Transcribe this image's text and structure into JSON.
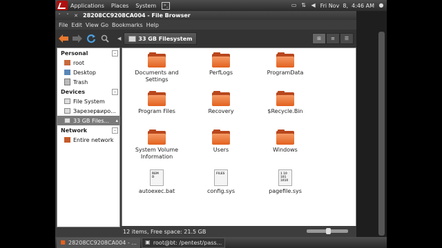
{
  "topbar": {
    "menus": [
      "Applications",
      "Places",
      "System"
    ],
    "clock": "Fri Nov  8,  4:46 AM"
  },
  "window": {
    "title": "28208CC9208CA004 - File Browser",
    "menu": [
      "File",
      "Edit",
      "View",
      "Go",
      "Bookmarks",
      "Help"
    ]
  },
  "toolbar": {
    "path_label": "33 GB Filesystem"
  },
  "sidebar": {
    "sections": [
      {
        "title": "Personal",
        "items": [
          {
            "label": "root",
            "icon": "home-folder-icon"
          },
          {
            "label": "Desktop",
            "icon": "desktop-icon"
          },
          {
            "label": "Trash",
            "icon": "trash-icon"
          }
        ]
      },
      {
        "title": "Devices",
        "items": [
          {
            "label": "File System",
            "icon": "drive-icon"
          },
          {
            "label": "Зарезервиро...",
            "icon": "drive-icon"
          },
          {
            "label": "33 GB Files...",
            "icon": "drive-icon",
            "selected": true
          }
        ]
      },
      {
        "title": "Network",
        "items": [
          {
            "label": "Entire network",
            "icon": "network-icon"
          }
        ]
      }
    ]
  },
  "files": [
    {
      "name": "Documents and Settings",
      "type": "folder"
    },
    {
      "name": "PerfLogs",
      "type": "folder"
    },
    {
      "name": "ProgramData",
      "type": "folder"
    },
    {
      "name": "Program Files",
      "type": "folder"
    },
    {
      "name": "Recovery",
      "type": "folder"
    },
    {
      "name": "$Recycle.Bin",
      "type": "folder"
    },
    {
      "name": "System Volume Information",
      "type": "folder"
    },
    {
      "name": "Users",
      "type": "folder"
    },
    {
      "name": "Windows",
      "type": "folder"
    },
    {
      "name": "autoexec.bat",
      "type": "file",
      "preview": "REM D"
    },
    {
      "name": "config.sys",
      "type": "file",
      "preview": "FILES"
    },
    {
      "name": "pagefile.sys",
      "type": "file",
      "preview": "1 10 101 1010"
    }
  ],
  "status": {
    "text": "12 items, Free space: 21.5 GB"
  },
  "taskbar": {
    "tasks": [
      "28208CC9208CA004 - ...",
      "root@bt: /pentest/pass..."
    ]
  }
}
